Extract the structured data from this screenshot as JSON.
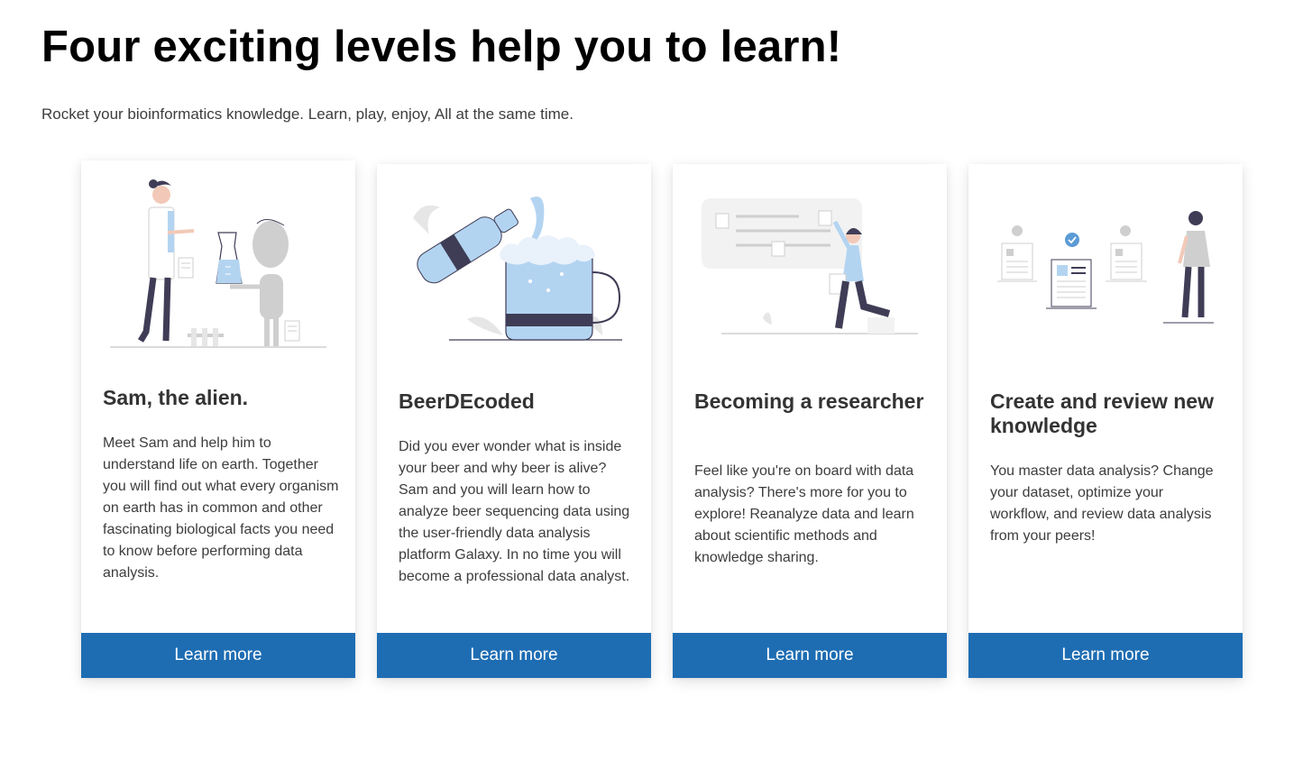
{
  "header": {
    "title": "Four exciting levels help you to learn!",
    "subtitle": "Rocket your bioinformatics knowledge. Learn, play, enjoy, All at the same time."
  },
  "cards": [
    {
      "illustration": "scientist-and-alien-illustration",
      "title": "Sam, the alien.",
      "description": "Meet Sam and help him to understand life on earth. Together you will find out what every organism on earth has in common and other fascinating biological facts you need to know before performing data analysis.",
      "button_label": "Learn more"
    },
    {
      "illustration": "beer-bottle-and-mug-illustration",
      "title": "BeerDEcoded",
      "description": "Did you ever wonder what is inside your beer and why beer is alive? Sam and you will learn how to analyze beer sequencing data using the user-friendly data analysis platform Galaxy. In no time you will become a professional data analyst.",
      "button_label": "Learn more"
    },
    {
      "illustration": "researcher-with-board-illustration",
      "title": "Becoming a researcher",
      "description": "Feel like you're on board with data analysis? There's more for you to explore! Reanalyze data and learn about scientific methods and knowledge sharing.",
      "button_label": "Learn more"
    },
    {
      "illustration": "document-review-illustration",
      "title": "Create and review new knowledge",
      "description": "You master data analysis? Change your dataset, optimize your workflow, and review data analysis from your peers!",
      "button_label": "Learn more"
    }
  ],
  "colors": {
    "accent": "#1e6db3",
    "illustration_light_blue": "#b3d4f1",
    "illustration_dark": "#3f3d56",
    "illustration_grey": "#cfcfcf"
  }
}
